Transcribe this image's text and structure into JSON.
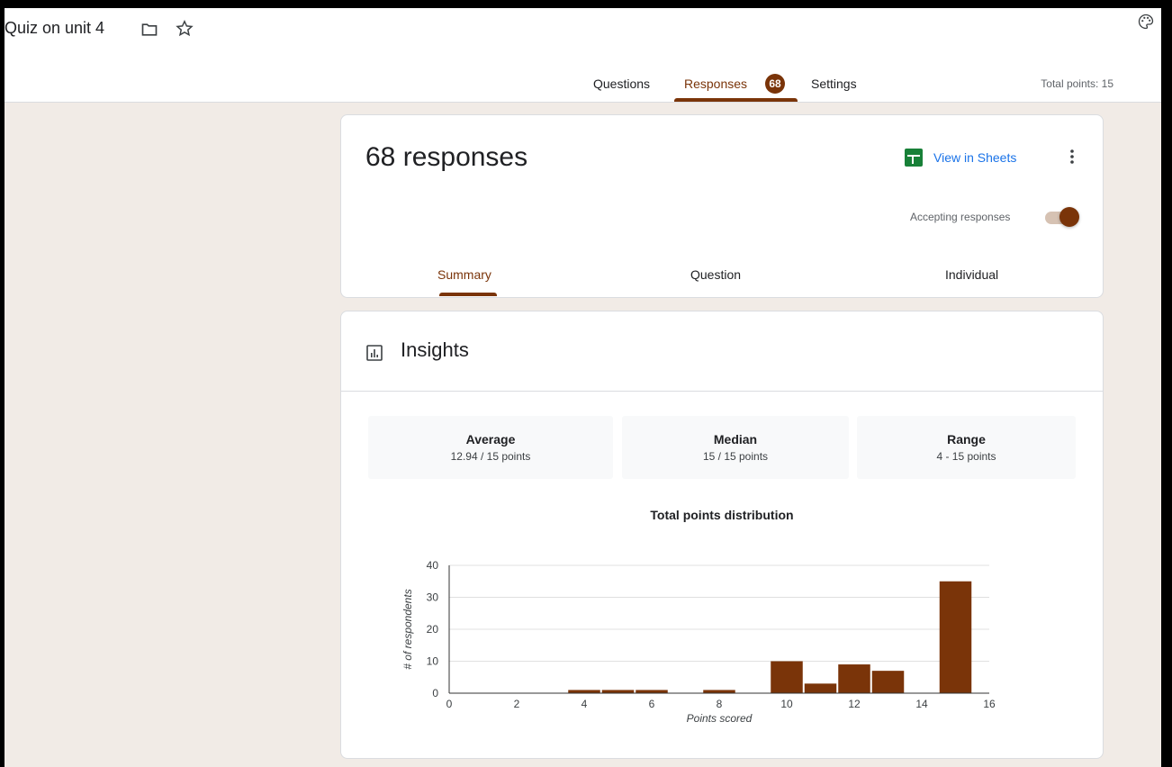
{
  "header": {
    "form_title": "Quiz on unit 4",
    "tabs": [
      {
        "label": "Questions",
        "active": false
      },
      {
        "label": "Responses",
        "active": true,
        "badge": "68"
      },
      {
        "label": "Settings",
        "active": false
      }
    ],
    "total_points": "Total points: 15"
  },
  "responses_card": {
    "count_text": "68 responses",
    "view_in_sheets": "View in Sheets",
    "accepting_label": "Accepting responses",
    "accepting_on": true,
    "subtabs": [
      {
        "label": "Summary",
        "active": true
      },
      {
        "label": "Question",
        "active": false
      },
      {
        "label": "Individual",
        "active": false
      }
    ]
  },
  "insights": {
    "title": "Insights",
    "stats": [
      {
        "label": "Average",
        "value": "12.94 / 15 points"
      },
      {
        "label": "Median",
        "value": "15 / 15 points"
      },
      {
        "label": "Range",
        "value": "4 - 15 points"
      }
    ]
  },
  "colors": {
    "accent": "#7a3409",
    "sheets_green": "#188038",
    "link_blue": "#1a73e8"
  },
  "icons": [
    "folder-icon",
    "star-icon",
    "palette-icon",
    "sheets-icon",
    "more-vert-icon",
    "insights-icon"
  ],
  "chart_data": {
    "type": "bar",
    "title": "Total points distribution",
    "xlabel": "Points scored",
    "ylabel": "# of respondents",
    "xlim": [
      0,
      16
    ],
    "ylim": [
      0,
      40
    ],
    "x_ticks": [
      0,
      2,
      4,
      6,
      8,
      10,
      12,
      14,
      16
    ],
    "y_ticks": [
      0,
      10,
      20,
      30,
      40
    ],
    "grid": true,
    "bar_color": "#7a3409",
    "x": [
      4,
      5,
      6,
      8,
      10,
      11,
      12,
      13,
      15
    ],
    "values": [
      1,
      1,
      1,
      1,
      10,
      3,
      9,
      7,
      35
    ]
  }
}
